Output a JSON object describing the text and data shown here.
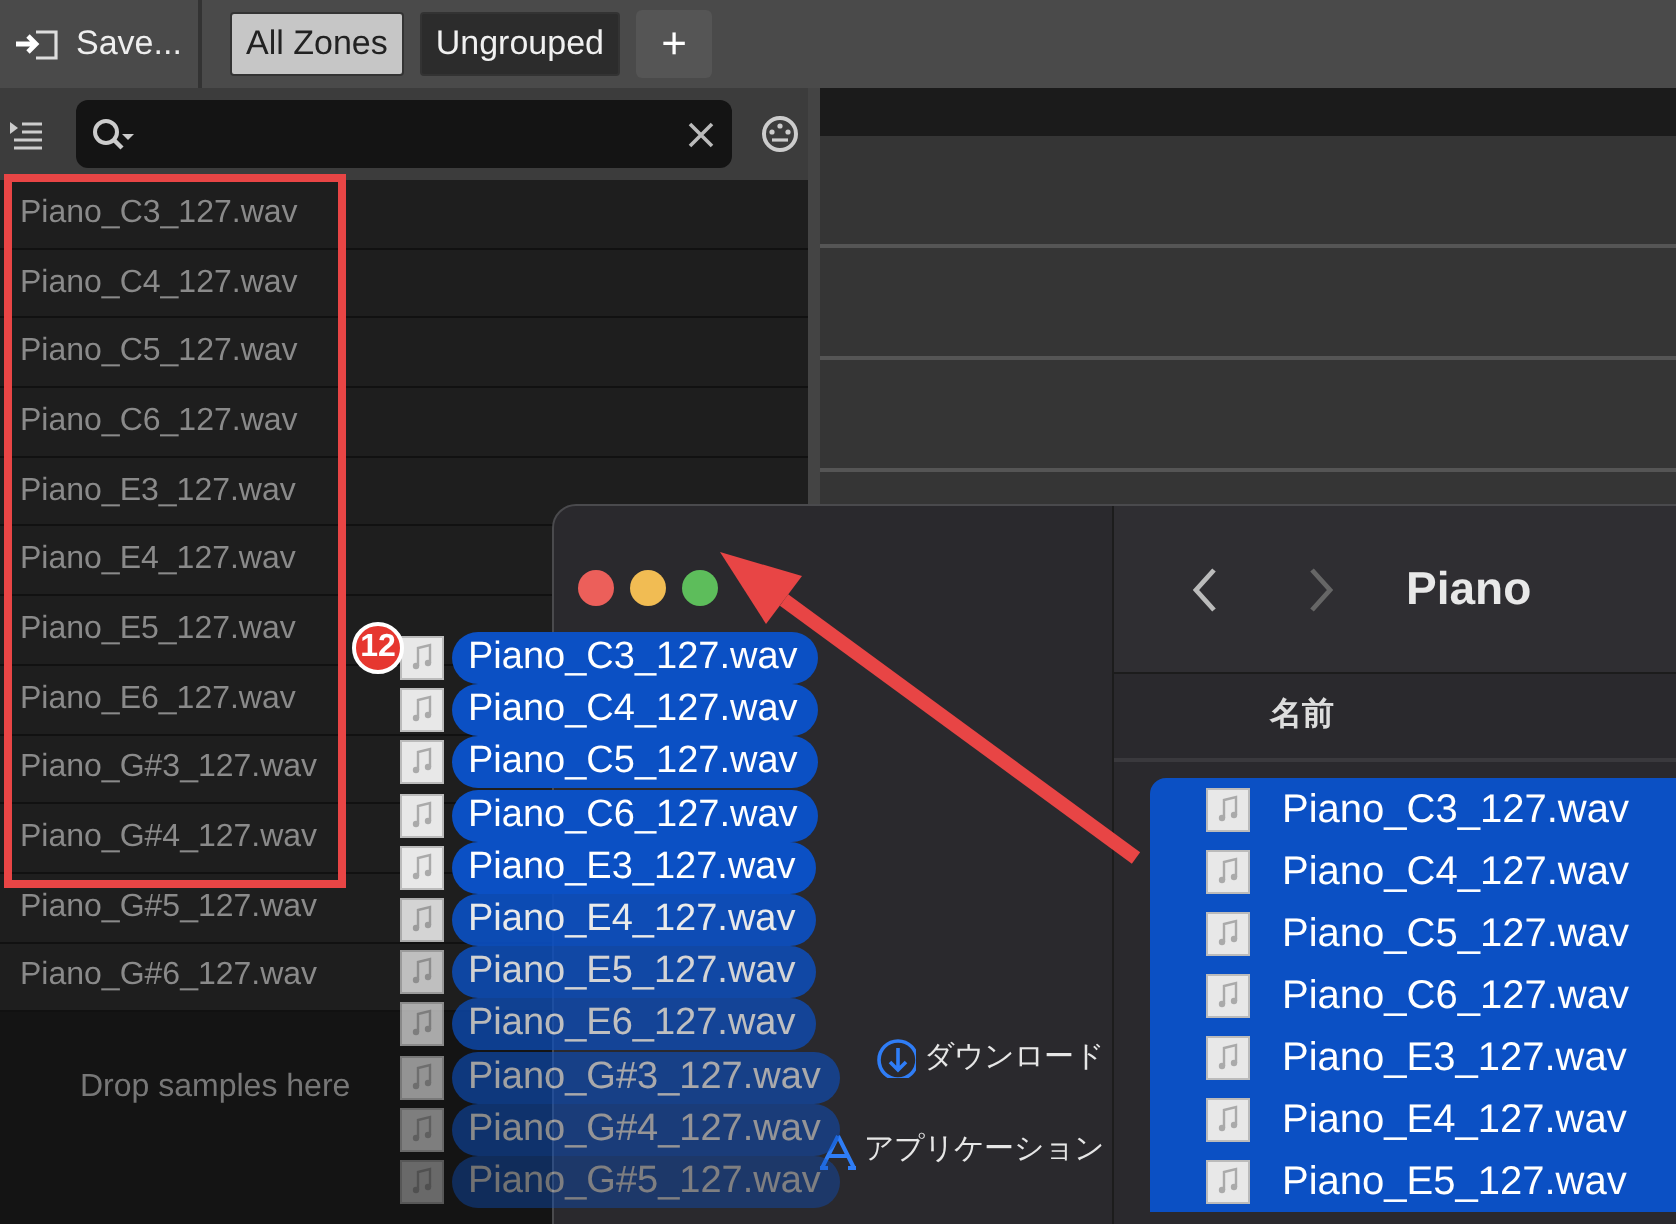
{
  "toolbar": {
    "save_button": "Save...",
    "tabs": [
      {
        "label": "All Zones",
        "selected": true
      },
      {
        "label": "Ungrouped",
        "selected": false
      }
    ],
    "add_button": "+"
  },
  "sample_list": {
    "rows": [
      "Piano_C3_127.wav",
      "Piano_C4_127.wav",
      "Piano_C5_127.wav",
      "Piano_C6_127.wav",
      "Piano_E3_127.wav",
      "Piano_E4_127.wav",
      "Piano_E5_127.wav",
      "Piano_E6_127.wav",
      "Piano_G#3_127.wav",
      "Piano_G#4_127.wav",
      "Piano_G#5_127.wav",
      "Piano_G#6_127.wav"
    ],
    "empty_hint": "Drop samples here"
  },
  "drag": {
    "count": "12",
    "items": [
      "Piano_C3_127.wav",
      "Piano_C4_127.wav",
      "Piano_C5_127.wav",
      "Piano_C6_127.wav",
      "Piano_E3_127.wav",
      "Piano_E4_127.wav",
      "Piano_E5_127.wav",
      "Piano_E6_127.wav",
      "Piano_G#3_127.wav",
      "Piano_G#4_127.wav",
      "Piano_G#5_127.wav"
    ]
  },
  "finder": {
    "title": "Piano",
    "sidebar": [
      {
        "label": "ダウンロード",
        "kind": "download"
      },
      {
        "label": "アプリケーション",
        "kind": "apps"
      }
    ],
    "column": "名前",
    "files": [
      {
        "name": "Piano_C3_127.wav",
        "selected": true
      },
      {
        "name": "Piano_C4_127.wav",
        "selected": true
      },
      {
        "name": "Piano_C5_127.wav",
        "selected": true
      },
      {
        "name": "Piano_C6_127.wav",
        "selected": true
      },
      {
        "name": "Piano_E3_127.wav",
        "selected": true
      },
      {
        "name": "Piano_E4_127.wav",
        "selected": true
      },
      {
        "name": "Piano_E5_127.wav",
        "selected": true
      }
    ]
  }
}
